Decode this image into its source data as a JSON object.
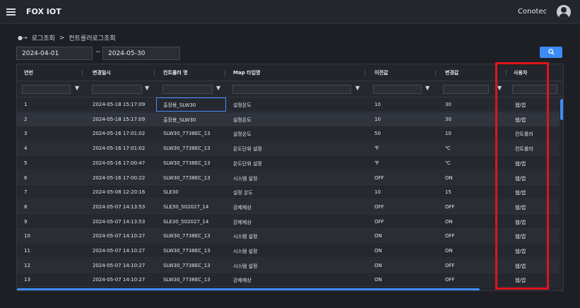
{
  "app": {
    "title": "FOX IOT",
    "user": "Conotec"
  },
  "icons": {
    "menu": "hamburger-menu-icon",
    "avatar": "user-avatar-icon",
    "search": "search-icon",
    "filter": "filter-funnel-icon",
    "breadcrumb": "log-icon"
  },
  "breadcrumb": {
    "part1": "로그조회",
    "separator": ">",
    "part2": "컨트롤러로그조회"
  },
  "filters": {
    "date_start": "2024-04-01",
    "date_separator": "~",
    "date_end": "2024-05-30"
  },
  "colors": {
    "accent": "#3d8cf5",
    "highlight": "#e0141c",
    "background": "#1d1f24"
  },
  "grid": {
    "columns": [
      "연번",
      "변경일시",
      "컨트롤러 명",
      "Map 타입명",
      "이전값",
      "변경값",
      "사용자"
    ],
    "rows": [
      [
        "1",
        "2024-05-18 15:17:09",
        "출장용_SLW30",
        "설정온도",
        "10",
        "30",
        "웹/앱"
      ],
      [
        "2",
        "2024-05-18 15:17:09",
        "출장용_SLW30",
        "설정온도",
        "10",
        "30",
        "웹/앱"
      ],
      [
        "3",
        "2024-05-16 17:01:02",
        "SLW30_7738EC_13",
        "설정온도",
        "50",
        "10",
        "컨트롤러"
      ],
      [
        "4",
        "2024-05-16 17:01:02",
        "SLW30_7738EC_13",
        "온도단위 설정",
        "℉",
        "℃",
        "컨트롤러"
      ],
      [
        "5",
        "2024-05-16 17:00:47",
        "SLW30_7738EC_13",
        "온도단위 설정",
        "℉",
        "℃",
        "웹/앱"
      ],
      [
        "6",
        "2024-05-16 17:00:22",
        "SLW30_7738EC_13",
        "시스템 설정",
        "OFF",
        "ON",
        "웹/앱"
      ],
      [
        "7",
        "2024-05-08 12:20:16",
        "SLE30",
        "설정 온도",
        "10",
        "15",
        "웹/앱"
      ],
      [
        "8",
        "2024-05-07 14:13:53",
        "SLE30_502027_14",
        "강제제상",
        "OFF",
        "OFF",
        "웹/앱"
      ],
      [
        "9",
        "2024-05-07 14:13:53",
        "SLE30_502027_14",
        "강제제상",
        "OFF",
        "ON",
        "웹/앱"
      ],
      [
        "10",
        "2024-05-07 14:10:27",
        "SLW30_7738EC_13",
        "시스템 설정",
        "ON",
        "OFF",
        "웹/앱"
      ],
      [
        "11",
        "2024-05-07 14:10:27",
        "SLW30_7738EC_13",
        "시스템 설정",
        "ON",
        "ON",
        "웹/앱"
      ],
      [
        "12",
        "2024-05-07 14:10:27",
        "SLW30_7738EC_13",
        "시스템 설정",
        "ON",
        "OFF",
        "웹/앱"
      ],
      [
        "13",
        "2024-05-07 14:10:27",
        "SLW30_7738EC_13",
        "강제제상",
        "ON",
        "OFF",
        "웹/앱"
      ]
    ]
  }
}
